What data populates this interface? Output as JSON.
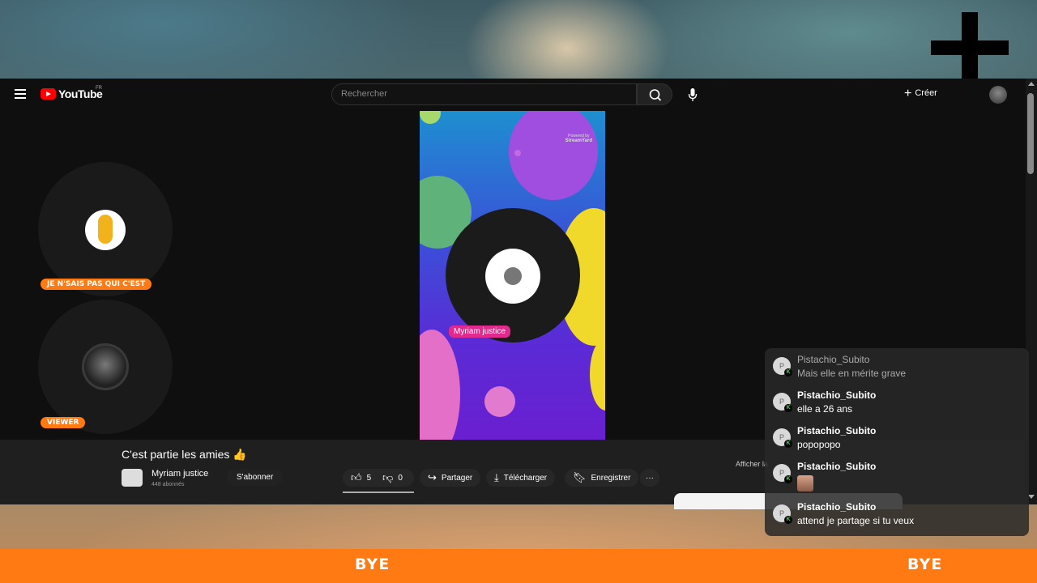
{
  "topbar": {
    "brand": "YouTube",
    "region": "FR",
    "search_placeholder": "Rechercher",
    "create_label": "Créer"
  },
  "video": {
    "watermark_line1": "Powered by",
    "watermark_brand": "StreamYard",
    "speaker_name": "Myriam justice"
  },
  "participants": [
    {
      "tag": "JE N'SAIS PAS QUI C'EST"
    },
    {
      "tag": "VIEWER"
    }
  ],
  "info": {
    "title": "C'est partie les amies 👍",
    "channel_name": "Myriam justice",
    "subscribers": "448 abonnés",
    "subscribe_label": "S'abonner",
    "likes": "5",
    "dislikes": "0",
    "share_label": "Partager",
    "download_label": "Télécharger",
    "save_label": "Enregistrer",
    "more_label": "···",
    "afficher_label": "Afficher la"
  },
  "chat": {
    "messages": [
      {
        "user": "Pistachio_Subito",
        "text": "Mais elle en mérite grave",
        "avatar": "P"
      },
      {
        "user": "Pistachio_Subito",
        "text": "elle a 26 ans",
        "avatar": "P"
      },
      {
        "user": "Pistachio_Subito",
        "text": "popopopo",
        "avatar": "P"
      },
      {
        "user": "Pistachio_Subito",
        "text": "",
        "avatar": "P",
        "emote": "face-emote"
      },
      {
        "user": "Pistachio_Subito",
        "text": "attend je partage si tu veux",
        "avatar": "P"
      }
    ]
  },
  "footer": {
    "left_text": "BYE",
    "right_text": "BYE"
  },
  "colors": {
    "accent": "#ff7a12",
    "youtube_red": "#ff0000",
    "name_tag": "#e22a8e"
  }
}
